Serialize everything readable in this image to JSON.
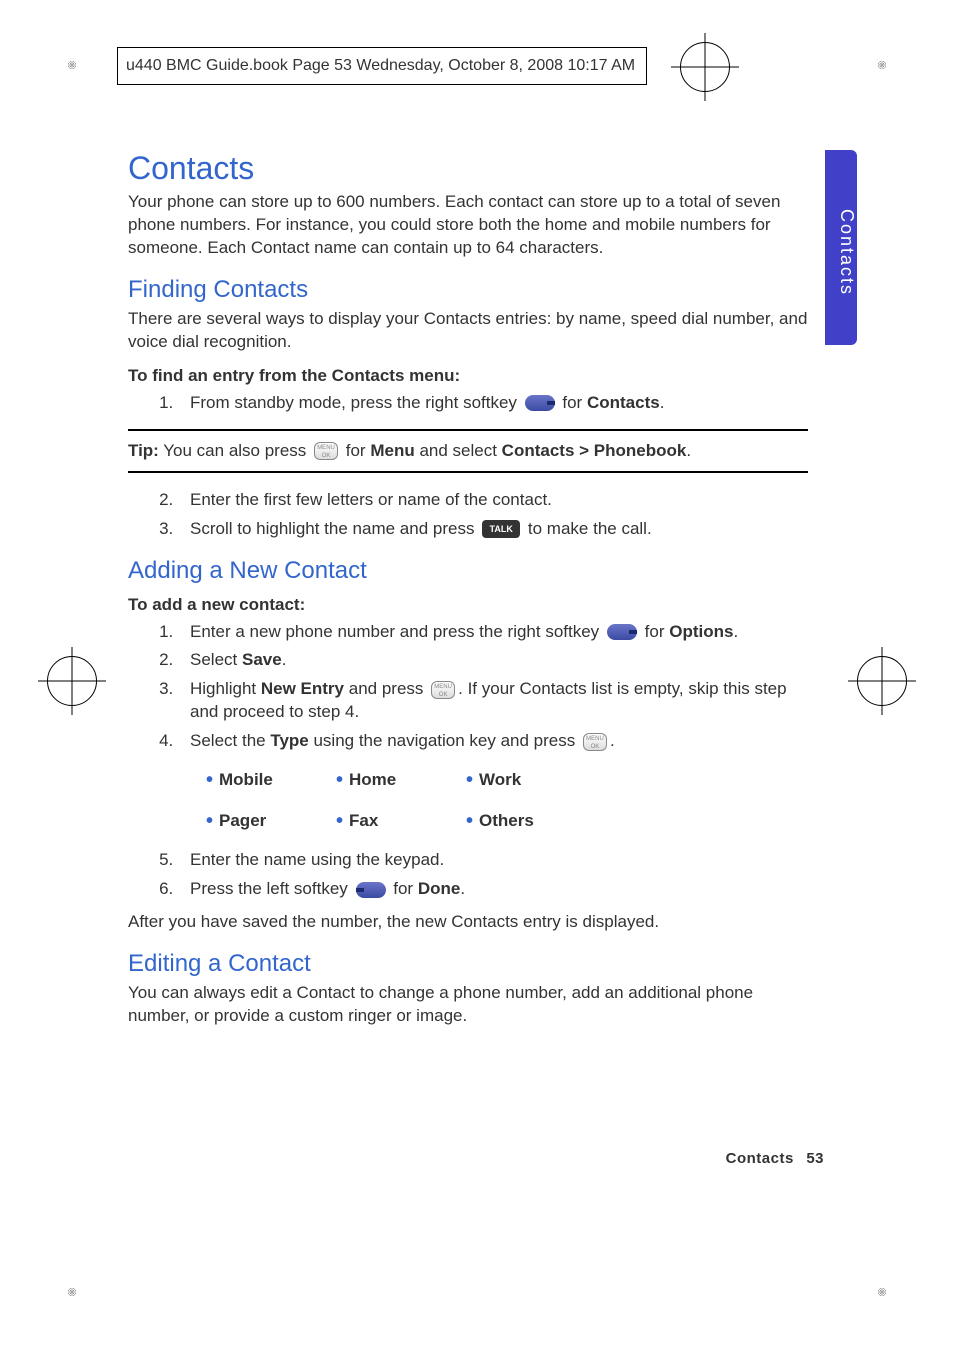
{
  "header": "u440 BMC Guide.book  Page 53  Wednesday, October 8, 2008  10:17 AM",
  "sidetab": "Contacts",
  "h1": "Contacts",
  "intro": "Your phone can store up to 600 numbers. Each contact can store up to a total of seven phone numbers. For instance, you could store both the home and mobile numbers for someone. Each Contact name can contain up to 64 characters.",
  "finding": {
    "heading": "Finding Contacts",
    "intro": "There are several ways to display your Contacts entries: by name, speed dial number, and voice dial recognition.",
    "subhead": "To find an entry from the Contacts menu:",
    "step1_a": "From standby mode, press the right softkey ",
    "step1_b": " for ",
    "step1_c": "Contacts",
    "step1_d": ".",
    "tip_a": "Tip:",
    "tip_b": " You can also press ",
    "tip_c": " for ",
    "tip_d": "Menu",
    "tip_e": " and select ",
    "tip_f": "Contacts > Phonebook",
    "tip_g": ".",
    "step2": "Enter the first few letters or name of the contact.",
    "step3_a": "Scroll to highlight the name and press ",
    "step3_b": " to make the call."
  },
  "adding": {
    "heading": "Adding a New Contact",
    "subhead": "To add a new contact:",
    "step1_a": "Enter a new phone number and press the right softkey ",
    "step1_b": " for ",
    "step1_c": "Options",
    "step1_d": ".",
    "step2_a": "Select ",
    "step2_b": "Save",
    "step2_c": ".",
    "step3_a": "Highlight ",
    "step3_b": "New Entry",
    "step3_c": " and press ",
    "step3_d": ". If your Contacts list is empty, skip this step and proceed to step 4.",
    "step4_a": "Select the ",
    "step4_b": "Type",
    "step4_c": " using the navigation key and press ",
    "step4_d": ".",
    "types": [
      "Mobile",
      "Home",
      "Work",
      "Pager",
      "Fax",
      "Others"
    ],
    "step5": "Enter the name using the keypad.",
    "step6_a": "Press the left softkey ",
    "step6_b": " for ",
    "step6_c": "Done",
    "step6_d": ".",
    "outro": "After you have saved the number, the new Contacts entry is displayed."
  },
  "editing": {
    "heading": "Editing a Contact",
    "intro": "You can always edit a Contact to change a phone number, add an additional phone number, or provide a custom ringer or image."
  },
  "footer": {
    "section": "Contacts",
    "page": "53"
  },
  "chart_data": {
    "type": "table",
    "title": "Phone number types",
    "categories": [
      "Mobile",
      "Home",
      "Work",
      "Pager",
      "Fax",
      "Others"
    ]
  }
}
